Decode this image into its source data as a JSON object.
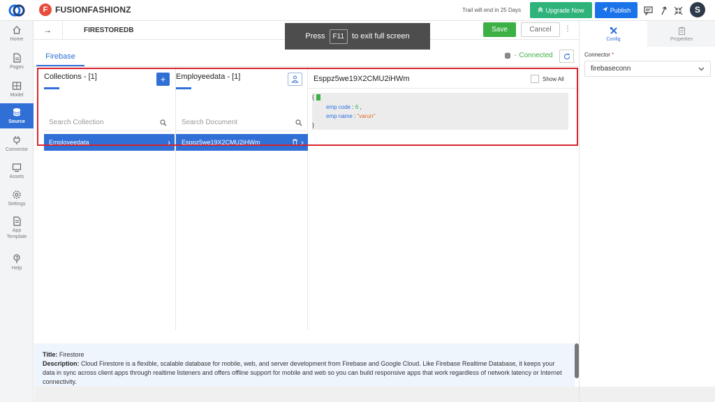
{
  "header": {
    "brand_letter": "F",
    "brand_name": "FUSIONFASHIONZ",
    "trail_text": "Trail will end in 25 Days",
    "upgrade_label": "Upgrade Now",
    "publish_label": "Publish",
    "avatar_initial": "S",
    "accent_color": "#1a73e8",
    "upgrade_color": "#2fb37b"
  },
  "sidebar": {
    "items": [
      {
        "label": "Home",
        "icon": "home-icon"
      },
      {
        "label": "Pages",
        "icon": "page-icon"
      },
      {
        "label": "Model",
        "icon": "table-icon"
      },
      {
        "label": "Source",
        "icon": "database-icon",
        "active": true
      },
      {
        "label": "Connector",
        "icon": "plug-icon"
      },
      {
        "label": "Assets",
        "icon": "monitor-icon"
      },
      {
        "label": "Settings",
        "icon": "gear-icon"
      },
      {
        "label": "App Template",
        "icon": "template-icon"
      },
      {
        "label": "Help",
        "icon": "help-icon"
      }
    ]
  },
  "subbar": {
    "page_name": "FIRESTOREDB",
    "save_label": "Save",
    "cancel_label": "Cancel"
  },
  "toast": {
    "press": "Press",
    "key": "F11",
    "rest": "to exit full screen"
  },
  "tabs": {
    "firebase": "Firebase",
    "status": "Connected"
  },
  "collections": {
    "header": "Collections - [1]",
    "search_placeholder": "Search Collection",
    "selected": "Employeedata"
  },
  "documents": {
    "header": "Employeedata - [1]",
    "search_placeholder": "Search Document",
    "selected": "Esppz5we19X2CMU2iHWm"
  },
  "document_view": {
    "title": "Esppz5we19X2CMU2iHWm",
    "show_all": "Show All",
    "open_brace": "{",
    "close_brace": "}",
    "fields": [
      {
        "key": "emp code",
        "value": "6",
        "type": "number"
      },
      {
        "key": "emp name",
        "value": "\"varun\"",
        "type": "string"
      }
    ]
  },
  "description": {
    "title_label": "Title:",
    "title_value": "Firestore",
    "desc_label": "Description:",
    "desc_value": "Cloud Firestore is a flexible, scalable database for mobile, web, and server development from Firebase and Google Cloud. Like Firebase Realtime Database, it keeps your data in sync across client apps through realtime listeners and offers offline support for mobile and web so you can build responsive apps that work regardless of network latency or Internet connectivity."
  },
  "right_panel": {
    "tab_config": "Config",
    "tab_properties": "Properties",
    "connector_label": "Connector",
    "connector_required": "*",
    "connector_value": "firebaseconn"
  }
}
